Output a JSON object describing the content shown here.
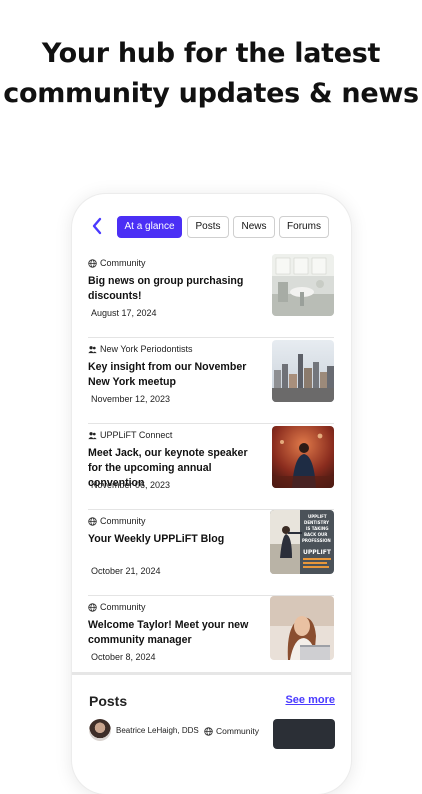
{
  "headline": {
    "line1": "Your hub for the latest",
    "line2": "community updates & news"
  },
  "tabs": [
    {
      "label": "At a glance",
      "active": true
    },
    {
      "label": "Posts",
      "active": false
    },
    {
      "label": "News",
      "active": false
    },
    {
      "label": "Forums",
      "active": false
    }
  ],
  "feed": [
    {
      "group": "Community",
      "group_icon": "globe-icon",
      "title": "Big news on group purchasing discounts!",
      "date": "August 17, 2024",
      "thumb": "office-interior"
    },
    {
      "group": "New York Periodontists",
      "group_icon": "people-icon",
      "title": "Key insight from our November New York meetup",
      "date": "November 12, 2023",
      "thumb": "city-skyline"
    },
    {
      "group": "UPPLiFT Connect",
      "group_icon": "people-icon",
      "title": "Meet Jack, our keynote speaker for the upcoming annual convention",
      "date": "November 06, 2023",
      "thumb": "speaker-audience"
    },
    {
      "group": "Community",
      "group_icon": "globe-icon",
      "title": "Your Weekly UPPLiFT Blog",
      "date": "October 21, 2024",
      "thumb": "blog-cover"
    },
    {
      "group": "Community",
      "group_icon": "globe-icon",
      "title": "Welcome Taylor! Meet your new community manager",
      "date": "October 8, 2024",
      "thumb": "woman-laptop"
    }
  ],
  "blog_thumb_text": "UPPLIFT DENTISTRY IS TAKING BACK OUR PROFESSION",
  "posts": {
    "title": "Posts",
    "see_more": "See more",
    "first": {
      "author": "Beatrice LeHaigh, DDS",
      "group": "Community"
    }
  },
  "colors": {
    "accent": "#4b2ff5",
    "link": "#4a3aff"
  }
}
